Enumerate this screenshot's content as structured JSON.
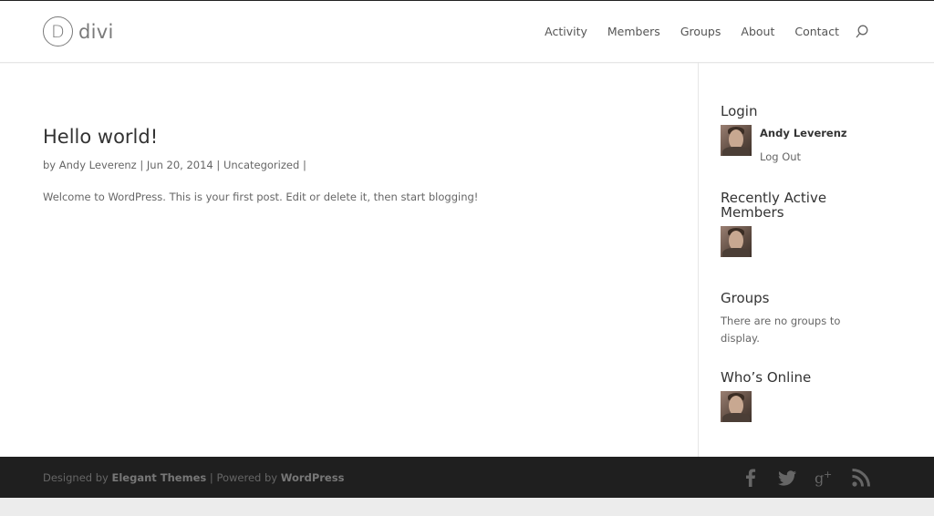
{
  "header": {
    "logo_letter": "D",
    "logo_text": "divi",
    "nav": [
      {
        "label": "Activity"
      },
      {
        "label": "Members"
      },
      {
        "label": "Groups"
      },
      {
        "label": "About"
      },
      {
        "label": "Contact"
      }
    ],
    "search_icon": "search-icon"
  },
  "post": {
    "title": "Hello world!",
    "meta_by": "by",
    "author": "Andy Leverenz",
    "sep1": "|",
    "date": "Jun 20, 2014",
    "sep2": "|",
    "category": "Uncategorized",
    "sep3": "|",
    "body": "Welcome to WordPress. This is your first post. Edit or delete it, then start blogging!"
  },
  "sidebar": {
    "login": {
      "title": "Login",
      "user_name": "Andy Leverenz",
      "logout_label": "Log Out"
    },
    "recent": {
      "title": "Recently Active Members"
    },
    "groups": {
      "title": "Groups",
      "empty_text": "There are no groups to display."
    },
    "online": {
      "title": "Who’s Online"
    }
  },
  "footer": {
    "designed_by": "Designed by",
    "elegant": "Elegant Themes",
    "separator": "|",
    "powered_by": "Powered by",
    "wordpress": "WordPress",
    "social": [
      "facebook-icon",
      "twitter-icon",
      "google-plus-icon",
      "rss-icon"
    ]
  },
  "colors": {
    "footer_bg": "#1f1f1f",
    "text": "#666666",
    "heading": "#333333"
  }
}
